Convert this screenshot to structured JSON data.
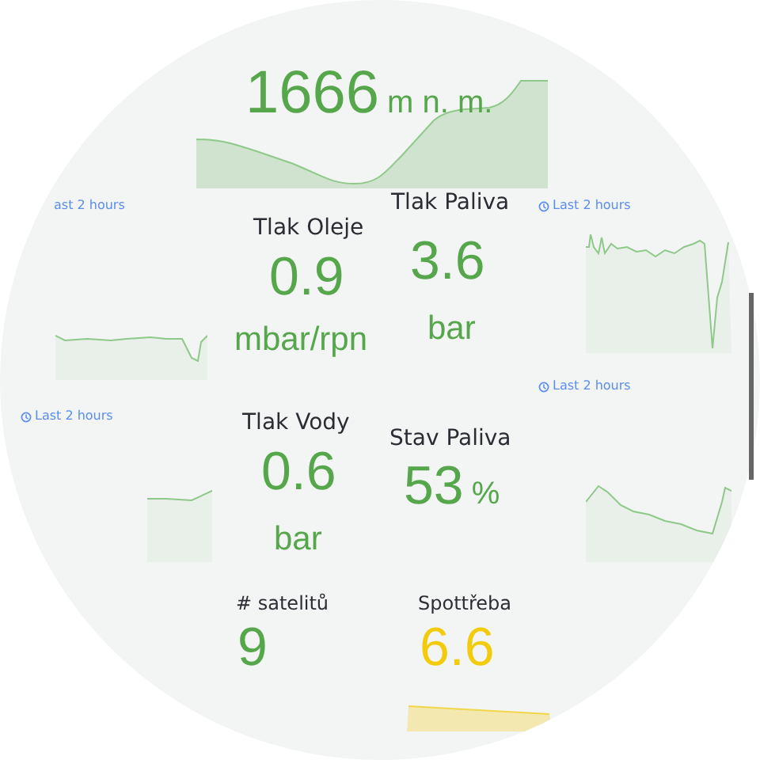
{
  "time_labels": [
    {
      "text": "ast 2 hours",
      "clock_icon": false
    },
    {
      "text": "Last 2 hours",
      "clock_icon": true
    },
    {
      "text": "Last 2 hours",
      "clock_icon": true
    },
    {
      "text": "Last 2 hours",
      "clock_icon": true
    }
  ],
  "panels": [
    {
      "value": "1666",
      "unit": "m n. m.",
      "color": "#56a64b"
    },
    {
      "title": "Tlak Oleje",
      "value": "0.9",
      "unit": "mbar/rpn",
      "color": "#56a64b"
    },
    {
      "title": "Tlak Paliva",
      "value": "3.6",
      "unit": "bar",
      "color": "#56a64b"
    },
    {
      "title": "Tlak Vody",
      "value": "0.6",
      "unit": "bar",
      "color": "#56a64b"
    },
    {
      "title": "Stav Paliva",
      "value": "53",
      "unit": "%",
      "color": "#56a64b"
    },
    {
      "title": "# satelitů",
      "value": "9",
      "color": "#56a64b"
    },
    {
      "title": "Spottřeba",
      "value": "6.6",
      "color": "#f2cc0c"
    }
  ]
}
